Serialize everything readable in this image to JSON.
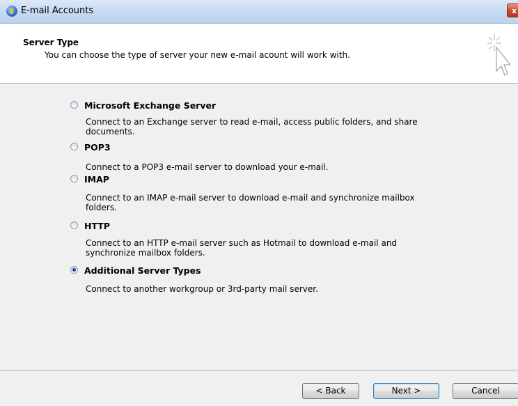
{
  "window": {
    "title": "E-mail Accounts",
    "close_label": "x"
  },
  "header": {
    "title": "Server Type",
    "subtitle": "You can choose the type of server your new e-mail acount will work with."
  },
  "options": [
    {
      "label": "Microsoft Exchange Server",
      "description": "Connect to an Exchange server to read e-mail, access public folders, and share documents.",
      "selected": false
    },
    {
      "label": "POP3",
      "description": "Connect to a POP3 e-mail server to download your e-mail.",
      "selected": false
    },
    {
      "label": "IMAP",
      "description": "Connect to an IMAP e-mail server to download e-mail and synchronize mailbox folders.",
      "selected": false
    },
    {
      "label": "HTTP",
      "description": "Connect to an HTTP e-mail server such as Hotmail to download e-mail and synchronize mailbox folders.",
      "selected": false
    },
    {
      "label": "Additional Server Types",
      "description": "Connect to another workgroup or 3rd-party mail server.",
      "selected": true
    }
  ],
  "buttons": {
    "back": "< Back",
    "next": "Next >",
    "cancel": "Cancel"
  },
  "icons": {
    "app": "outlook-globe-icon",
    "wizard": "sparkle-cursor-icon",
    "close": "close-icon"
  }
}
